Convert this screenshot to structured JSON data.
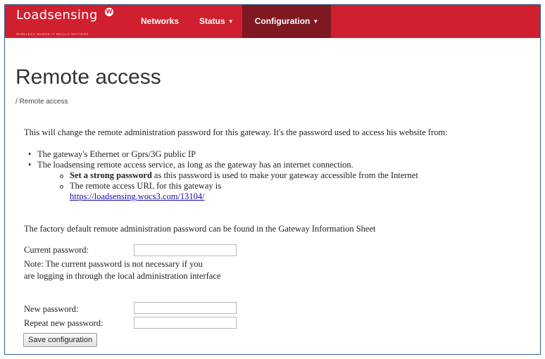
{
  "brand": {
    "name": "Loadsensing",
    "logo_glyph": "W",
    "tagline": "WIRELESS WHERE IT REALLY MATTERS"
  },
  "nav": {
    "networks": "Networks",
    "status": "Status",
    "configuration": "Configuration",
    "active": "configuration",
    "color": "#d01f2e",
    "active_color": "#7e1921"
  },
  "page": {
    "title": "Remote access",
    "breadcrumb": "/ Remote access"
  },
  "content": {
    "intro": "This will change the remote administration password for this gateway. It's the password used to access his website from:",
    "bullet1": "The gateway's Ethernet or Gprs/3G public IP",
    "bullet2": "The loadsensing remote access service, as long as the gateway has an internet connection.",
    "sub1_bold": "Set a strong password",
    "sub1_rest": " as this password is used to make your gateway accessible from the Internet",
    "sub2": "The remote access URL for this gateway is",
    "url": "https://loadsensing.wocs3.com/13104/",
    "factory_note": "The factory default remote administration password can be found in the Gateway Information Sheet"
  },
  "form": {
    "current_password_label": "Current password:",
    "current_password_value": "",
    "note_line1": "Note: The current password is not necessary if you",
    "note_line2": "are logging in through the local administration interface",
    "new_password_label": "New password:",
    "new_password_value": "",
    "repeat_password_label": "Repeat new password:",
    "repeat_password_value": "",
    "save_button": "Save configuration"
  }
}
